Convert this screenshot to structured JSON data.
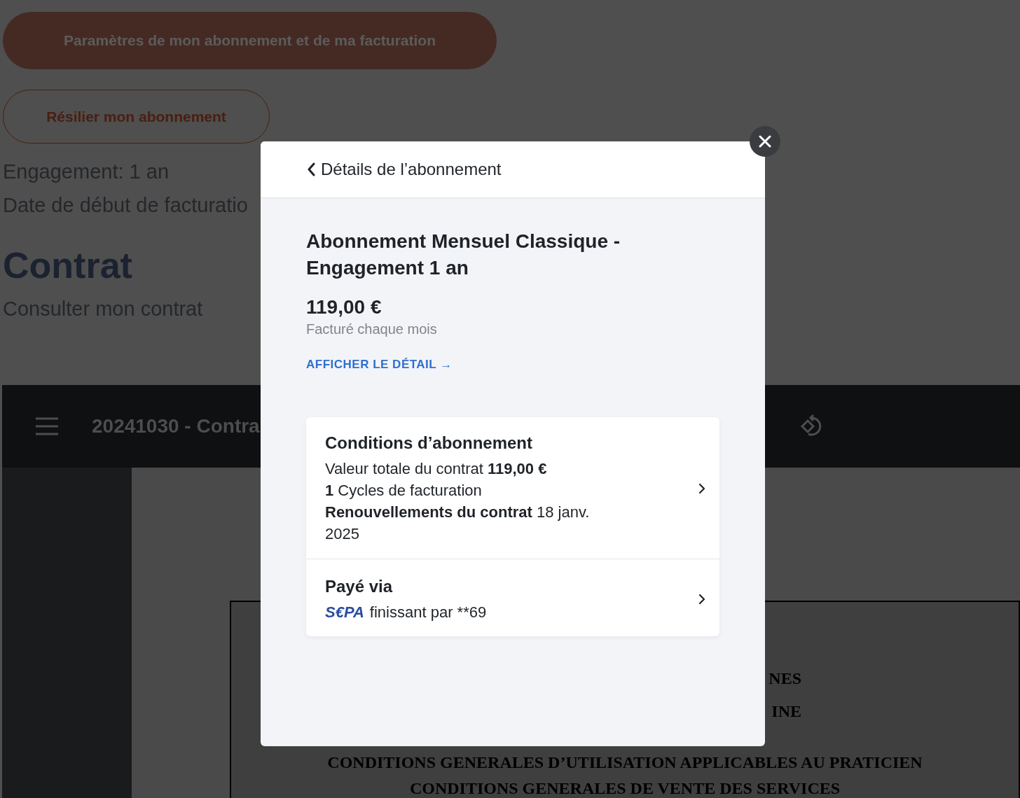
{
  "background": {
    "settings_button": "Paramètres de mon abonnement et de ma facturation",
    "cancel_button": "Résilier mon abonnement",
    "info_lines": [
      "Engagement: 1 an",
      "Date de début de facturatio"
    ],
    "section_title": "Contrat",
    "section_link": "Consulter mon contrat",
    "viewer": {
      "title": "20241030 - Contra",
      "document_lines": [
        "NES",
        "INE",
        "CONDITIONS GENERALES D’UTILISATION APPLICABLES AU PRATICIEN",
        "CONDITIONS GENERALES DE VENTE DES SERVICES"
      ]
    }
  },
  "modal": {
    "header_title": "Détails de l’abonnement",
    "plan_name": "Abonnement Mensuel Classique - Engagement 1 an",
    "price": "119,00 €",
    "billing": "Facturé chaque mois",
    "detail_link": "AFFICHER LE DÉTAIL →",
    "cards": [
      {
        "kind": "conditions",
        "title": "Conditions d’abonnement",
        "lines": [
          "Valeur totale du contrat **119,00 €**",
          "**1** Cycles de facturation",
          "**Renouvellements du contrat** 18 janv. 2025"
        ]
      },
      {
        "kind": "payment",
        "title": "Payé via",
        "logo": "S€PA",
        "text": "finissant par **69"
      }
    ]
  }
}
